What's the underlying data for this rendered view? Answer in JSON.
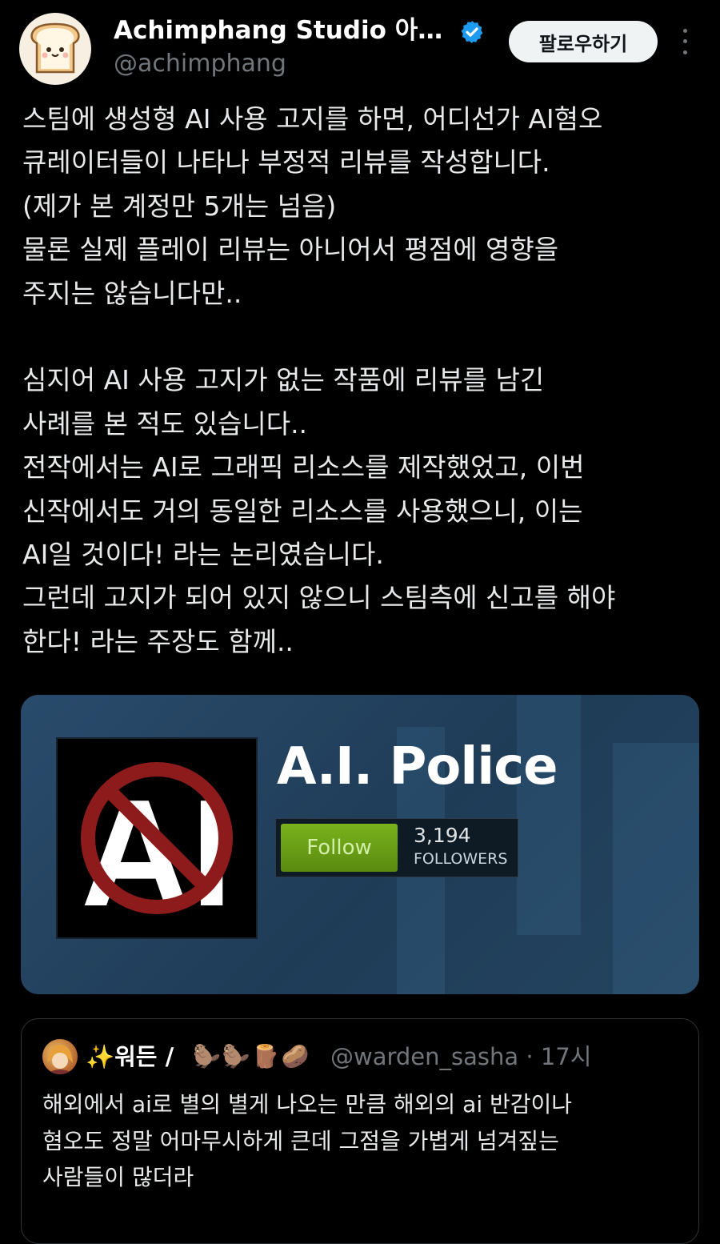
{
  "author": {
    "display_name": "Achimphang Studio 아침팡 스튜디오",
    "handle": "@achimphang",
    "avatar_icon": "bread-toast-icon",
    "verified_icon": "verified-badge-icon",
    "verified_color": "#1d9bf0"
  },
  "header": {
    "follow_label": "팔로우하기",
    "more_icon": "more-vertical-icon"
  },
  "tweet": {
    "text": "스팀에 생성형 AI 사용 고지를 하면, 어디선가 AI혐오\n큐레이터들이 나타나 부정적 리뷰를 작성합니다.\n(제가 본 계정만 5개는 넘음)\n물론 실제 플레이 리뷰는 아니어서 평점에 영향을\n주지는 않습니다만..\n\n심지어 AI 사용 고지가 없는 작품에 리뷰를 남긴\n사례를 본 적도 있습니다..\n전작에서는 AI로 그래픽 리소스를 제작했었고, 이번\n신작에서도 거의 동일한 리소스를 사용했으니, 이는\nAI일 것이다! 라는 논리였습니다.\n그런데 고지가 되어 있지 않으니 스팀측에 신고를 해야\n한다! 라는 주장도 함께.."
  },
  "media": {
    "group_name": "A.I. Police",
    "logo_text": "AI",
    "logo_icon": "no-ai-prohibition-icon",
    "follow_button": "Follow",
    "follower_count": "3,194",
    "follower_label": "FOLLOWERS",
    "accent_green": "#5c9a14"
  },
  "quote": {
    "avatar_icon": "anime-avatar-icon",
    "name": "✨워든 /",
    "emojis": [
      "🦫",
      "🦫",
      "🪵",
      "🥔"
    ],
    "handle": "@warden_sasha",
    "time": "· 17시",
    "text": "해외에서 ai로 별의 별게 나오는 만큼 해외의 ai 반감이나\n혐오도 정말 어마무시하게 큰데 그점을 가볍게 넘겨짚는\n사람들이 많더라"
  }
}
